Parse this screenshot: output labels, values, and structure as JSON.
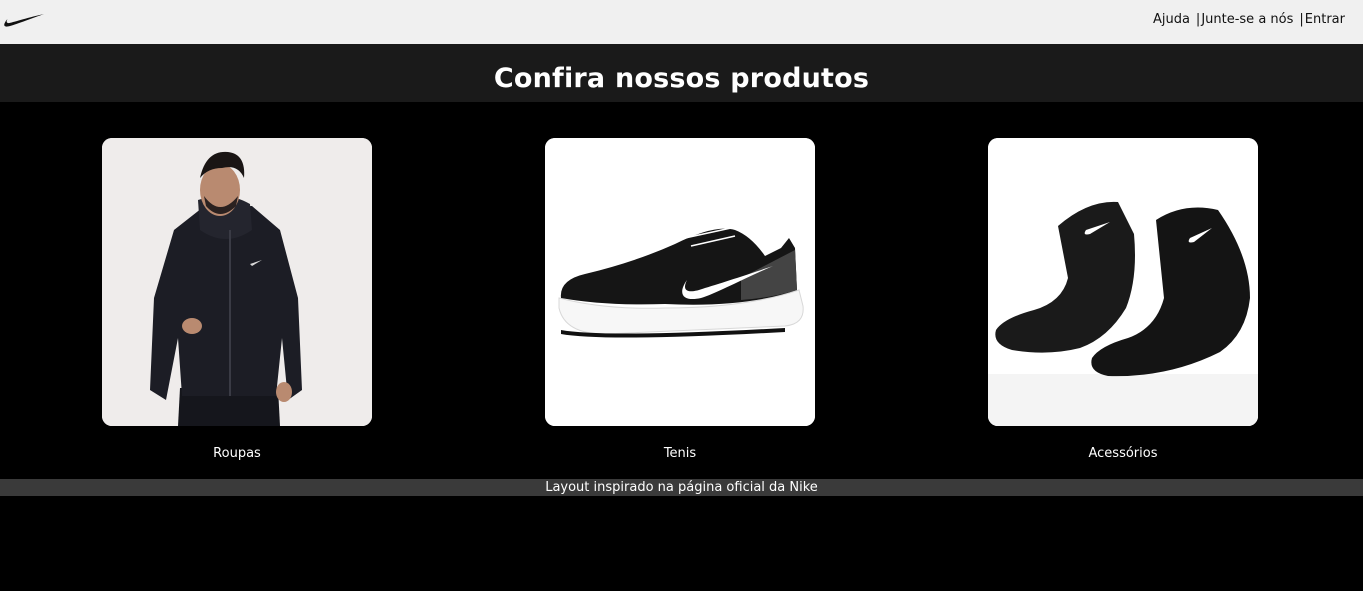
{
  "header": {
    "logo_icon": "nike-swoosh-icon",
    "nav": {
      "help": "Ajuda",
      "join": "Junte-se a nós",
      "login": "Entrar",
      "separator": "|"
    }
  },
  "title": "Confira nossos produtos",
  "products": [
    {
      "label": "Roupas",
      "image": "hoodie-model-image"
    },
    {
      "label": "Tenis",
      "image": "running-shoe-image"
    },
    {
      "label": "Acessórios",
      "image": "socks-image"
    }
  ],
  "footer": {
    "text": "Layout inspirado na página oficial da Nike"
  },
  "colors": {
    "background": "#000000",
    "topbar": "#f0f0f0",
    "titlebar": "#1a1a1a",
    "footer": "#3a3a3a"
  }
}
